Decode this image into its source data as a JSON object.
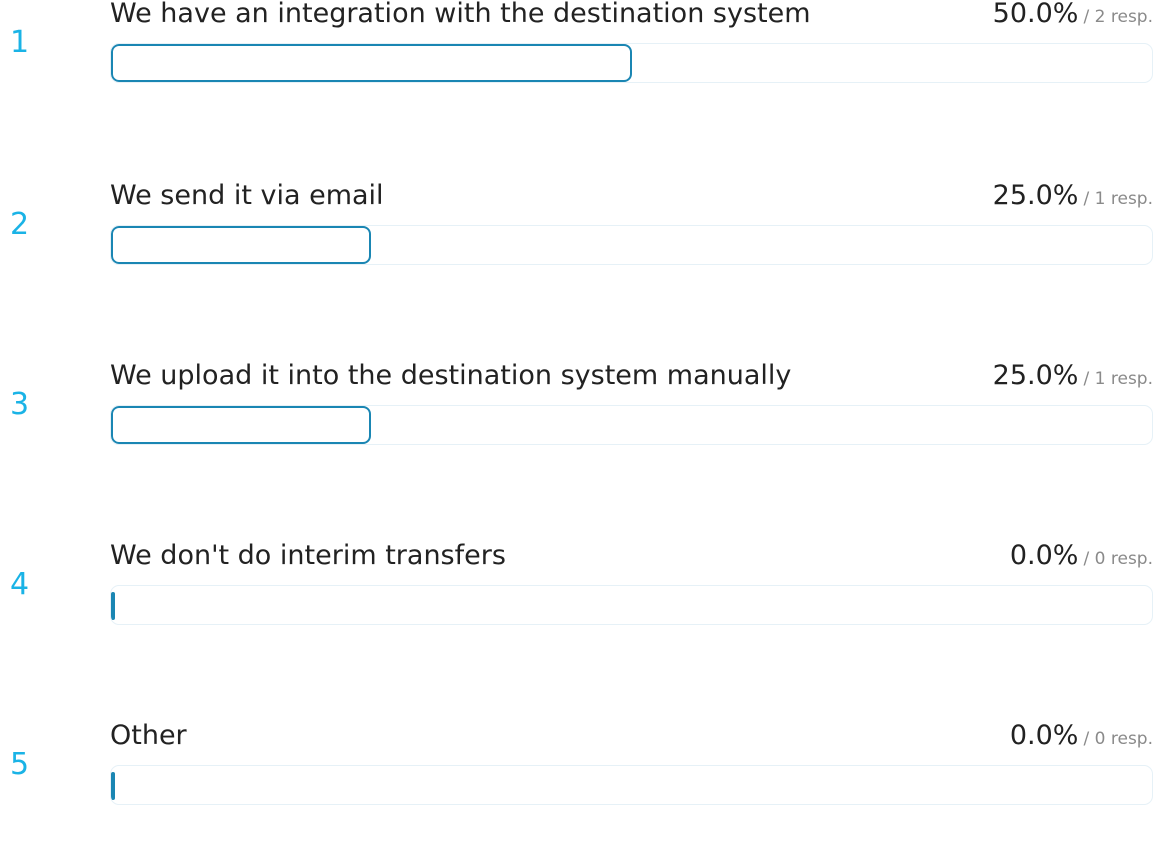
{
  "chart_data": {
    "type": "bar",
    "orientation": "horizontal",
    "categories": [
      "We have an integration with the destination system",
      "We send it via email",
      "We upload it into the destination system manually",
      "We don't do interim transfers",
      "Other"
    ],
    "values": [
      50.0,
      25.0,
      25.0,
      0.0,
      0.0
    ],
    "responses": [
      2,
      1,
      1,
      0,
      0
    ],
    "xlim": [
      0,
      100
    ],
    "index_color": "#1ab3e6",
    "bar_color": "#1a86b3",
    "track_color": "#e6f1f7"
  },
  "rows": [
    {
      "index": "1",
      "label": "We have an integration with the destination system",
      "pct": "50.0%",
      "resp": "/ 2 resp."
    },
    {
      "index": "2",
      "label": "We send it via email",
      "pct": "25.0%",
      "resp": "/ 1 resp."
    },
    {
      "index": "3",
      "label": "We upload it into the destination system manually",
      "pct": "25.0%",
      "resp": "/ 1 resp."
    },
    {
      "index": "4",
      "label": "We don't do interim transfers",
      "pct": "0.0%",
      "resp": "/ 0 resp."
    },
    {
      "index": "5",
      "label": "Other",
      "pct": "0.0%",
      "resp": "/ 0 resp."
    }
  ]
}
